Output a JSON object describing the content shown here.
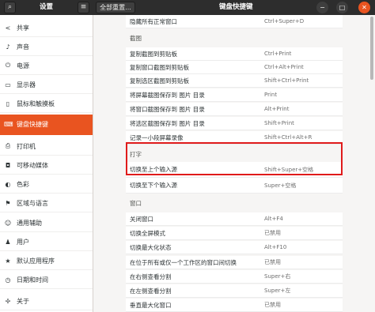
{
  "header": {
    "search_icon": "search-icon",
    "title": "设置",
    "menu_icon": "hamburger-icon",
    "reset_label": "全部重置...",
    "panel_title": "键盘快捷键",
    "minimize": "−",
    "maximize": "□",
    "close": "✕"
  },
  "sidebar": {
    "items": [
      {
        "icon": "share-icon",
        "glyph": "<",
        "label": "共享"
      },
      {
        "icon": "music-note-icon",
        "glyph": "♪",
        "label": "声音"
      },
      {
        "icon": "power-icon",
        "glyph": "⏻",
        "label": "电源"
      },
      {
        "icon": "display-icon",
        "glyph": "▭",
        "label": "显示器"
      },
      {
        "icon": "mouse-icon",
        "glyph": "▯",
        "label": "鼠标和触摸板"
      },
      {
        "icon": "keyboard-icon",
        "glyph": "⌨",
        "label": "键盘快捷键"
      },
      {
        "icon": "printer-icon",
        "glyph": "⎙",
        "label": "打印机"
      },
      {
        "icon": "removable-media-icon",
        "glyph": "◘",
        "label": "可移动媒体"
      },
      {
        "icon": "color-icon",
        "glyph": "◐",
        "label": "色彩"
      },
      {
        "icon": "region-flag-icon",
        "glyph": "⚑",
        "label": "区域与语言"
      },
      {
        "icon": "accessibility-icon",
        "glyph": "☺",
        "label": "通用辅助"
      },
      {
        "icon": "users-icon",
        "glyph": "♟",
        "label": "用户"
      },
      {
        "icon": "star-icon",
        "glyph": "★",
        "label": "默认应用程序"
      },
      {
        "icon": "clock-icon",
        "glyph": "◷",
        "label": "日期和时间"
      },
      {
        "icon": "info-icon",
        "glyph": "✢",
        "label": "关于"
      }
    ],
    "active_label": "键盘快捷键"
  },
  "content": {
    "rows_top": [
      {
        "action": "隐藏所有正常窗口",
        "accel": "Ctrl+Super+D"
      }
    ],
    "screenshot_section": "截图",
    "screenshot_rows": [
      {
        "action": "复制截图到剪贴板",
        "accel": "Ctrl+Print"
      },
      {
        "action": "复制窗口截图到剪贴板",
        "accel": "Ctrl+Alt+Print"
      },
      {
        "action": "复制选区截图到剪贴板",
        "accel": "Shift+Ctrl+Print"
      },
      {
        "action": "将屏幕截图保存到 图片 目录",
        "accel": "Print"
      },
      {
        "action": "将窗口截图保存到 图片 目录",
        "accel": "Alt+Print"
      },
      {
        "action": "将选区截图保存到 图片 目录",
        "accel": "Shift+Print"
      },
      {
        "action": "记录一小段屏幕录像",
        "accel": "Shift+Ctrl+Alt+R"
      }
    ],
    "typing_section": "打字",
    "typing_rows": [
      {
        "action": "切换至上个输入源",
        "accel": "Shift+Super+空格"
      },
      {
        "action": "切换至下个输入源",
        "accel": "Super+空格"
      }
    ],
    "window_section": "窗口",
    "window_rows": [
      {
        "action": "关闭窗口",
        "accel": "Alt+F4"
      },
      {
        "action": "切换全屏模式",
        "accel": "已禁用"
      },
      {
        "action": "切换最大化状态",
        "accel": "Alt+F10"
      },
      {
        "action": "在位于所有或仅一个工作区的窗口间切换",
        "accel": "已禁用"
      },
      {
        "action": "在右侧查看分割",
        "accel": "Super+右"
      },
      {
        "action": "在左侧查看分割",
        "accel": "Super+左"
      },
      {
        "action": "垂直最大化窗口",
        "accel": "已禁用"
      }
    ]
  },
  "colors": {
    "accent": "#e95420",
    "highlight_border": "#e01b1b",
    "headerbar": "#2d2d2d"
  }
}
